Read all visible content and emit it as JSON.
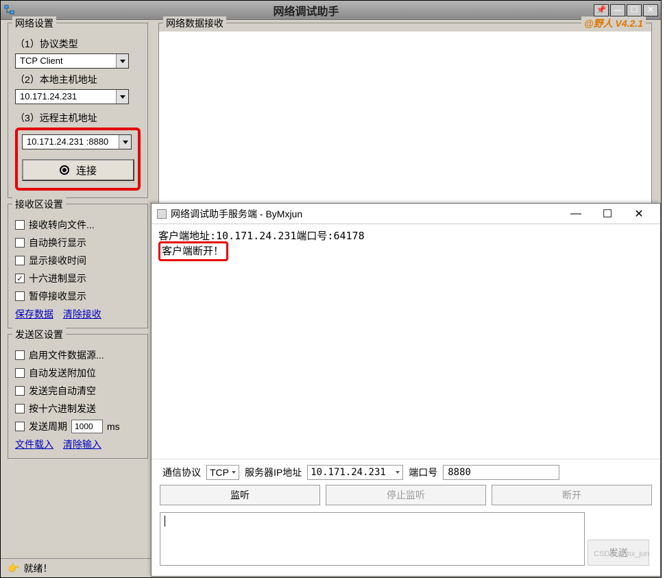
{
  "app": {
    "title": "网络调试助手",
    "status": "就绪！",
    "rx_group_title": "网络数据接收",
    "version_tag": "@野人 V4.2.1"
  },
  "network_settings": {
    "group_title": "网络设置",
    "protocol_label": "（1）协议类型",
    "protocol_value": "TCP Client",
    "local_host_label": "（2）本地主机地址",
    "local_host_value": "10.171.24.231",
    "remote_host_label": "（3）远程主机地址",
    "remote_host_value": "10.171.24.231 :8880",
    "connect_button": "连接"
  },
  "rx_settings": {
    "group_title": "接收区设置",
    "opts": [
      {
        "label": "接收转向文件...",
        "checked": false
      },
      {
        "label": "自动换行显示",
        "checked": false
      },
      {
        "label": "显示接收时间",
        "checked": false
      },
      {
        "label": "十六进制显示",
        "checked": true
      },
      {
        "label": "暂停接收显示",
        "checked": false
      }
    ],
    "links": {
      "save": "保存数据",
      "clear": "清除接收"
    }
  },
  "tx_settings": {
    "group_title": "发送区设置",
    "opts": [
      {
        "label": "启用文件数据源...",
        "checked": false
      },
      {
        "label": "自动发送附加位",
        "checked": false
      },
      {
        "label": "发送完自动清空",
        "checked": false
      },
      {
        "label": "按十六进制发送",
        "checked": false
      }
    ],
    "period_label": "发送周期",
    "period_value": "1000",
    "period_unit": "ms",
    "links": {
      "load": "文件载入",
      "clear": "清除输入"
    }
  },
  "server_window": {
    "title": "网络调试助手服务端 - ByMxjun",
    "log_line1": "客户端地址:10.171.24.231端口号:64178",
    "log_line2": "客户端断开！",
    "protocol_label": "通信协议",
    "protocol_value": "TCP",
    "server_ip_label": "服务器IP地址",
    "server_ip_value": "10.171.24.231",
    "port_label": "端口号",
    "port_value": "8880",
    "buttons": {
      "listen": "监听",
      "stop": "停止监听",
      "disconnect": "断开"
    },
    "send_button": "发送",
    "watermark": "CSDN @mx_jun"
  },
  "window_controls": {
    "minimize": "—",
    "maximize": "☐",
    "close": "✕"
  }
}
